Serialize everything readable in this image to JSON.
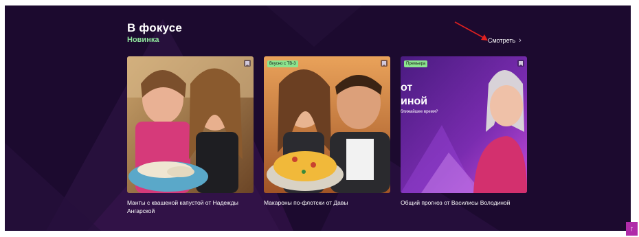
{
  "section": {
    "title": "В фокусе",
    "subtitle": "Новинка",
    "watch_label": "Смотреть",
    "watch_icon": "chevron-right-icon"
  },
  "cards": [
    {
      "badge": "",
      "caption": "Манты с квашеной капустой от Надежды Ангарской",
      "icon": "bookmark-icon"
    },
    {
      "badge": "Вкусно с ТВ-3",
      "caption": "Макароны по-флотски от Давы",
      "icon": "bookmark-icon"
    },
    {
      "badge": "Премьера",
      "caption": "Общий прогноз от Василисы Володиной",
      "overlay_line1": "от",
      "overlay_line2": "иной",
      "overlay_line3": "ближайшее время?",
      "icon": "bookmark-icon"
    }
  ],
  "scroll_top_icon": "arrow-up-icon",
  "colors": {
    "background": "#1c0a2f",
    "accent_green": "#8fe39c",
    "badge_green": "#8be48e",
    "scroll_button": "#b02ba9",
    "annotation_arrow": "#e02020"
  }
}
